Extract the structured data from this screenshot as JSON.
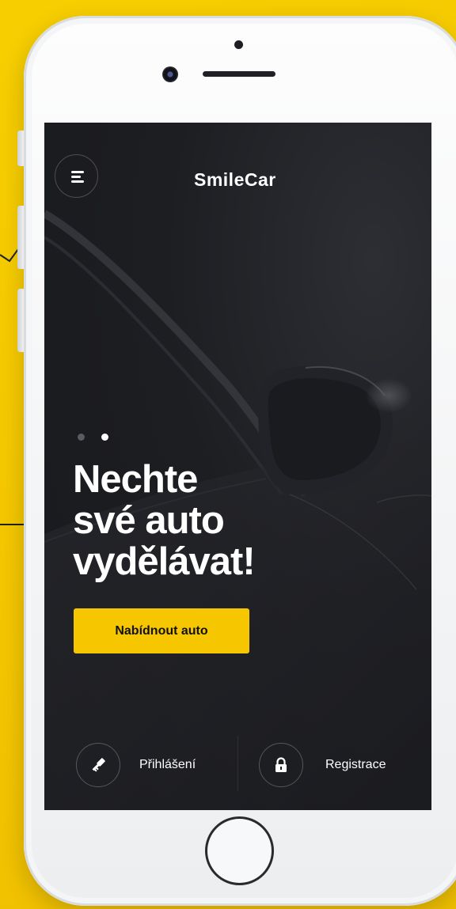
{
  "brand": {
    "logo_text_left": "Smile",
    "logo_text_c": "C",
    "logo_text_right": "ar",
    "accent_color": "#f6c700",
    "screen_color": "#1c1d21"
  },
  "header": {
    "menu_icon": "hamburger-menu-icon"
  },
  "hero": {
    "slider_total": 2,
    "slider_active_index": 2,
    "headline_line1": "Nechte",
    "headline_line2": "své auto",
    "headline_line3": "vydělávat!",
    "cta_label": "Nabídnout auto"
  },
  "bottom_nav": {
    "login": {
      "label": "Přihlášení",
      "icon": "key-icon"
    },
    "register": {
      "label": "Registrace",
      "icon": "lock-icon"
    }
  },
  "device": {
    "home_button_icon": "home-button-icon"
  }
}
